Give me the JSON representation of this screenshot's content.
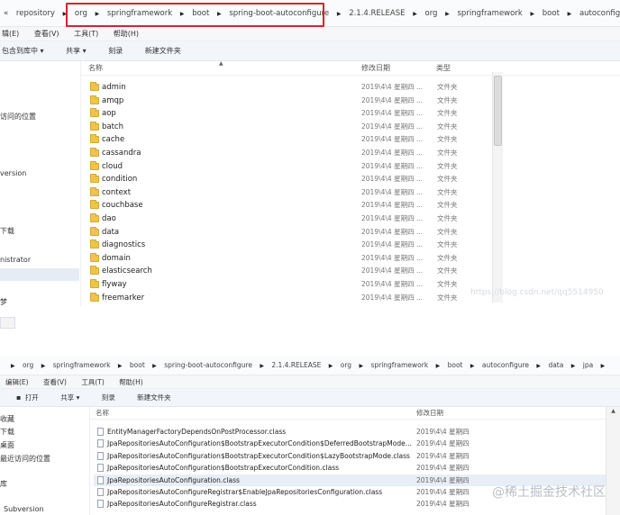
{
  "window1": {
    "breadcrumb": [
      "«",
      "repository",
      "org",
      "springframework",
      "boot",
      "spring-boot-autoconfigure",
      "2.1.4.RELEASE",
      "org",
      "springframework",
      "boot",
      "autoconfigure"
    ],
    "menu": [
      "辑(E)",
      "查看(V)",
      "工具(T)",
      "帮助(H)"
    ],
    "toolbar": [
      "包含到库中 ▾",
      "共享 ▾",
      "刻录",
      "新建文件夹"
    ],
    "nav": [
      "访问的位置",
      "version",
      "下载",
      "nistrator",
      "梦"
    ],
    "columns": {
      "name": "名称",
      "date": "修改日期",
      "type": "类型"
    },
    "rows": [
      {
        "name": "admin",
        "date": "2019\\4\\4 星期四 ...",
        "type": "文件夹"
      },
      {
        "name": "amqp",
        "date": "2019\\4\\4 星期四 ...",
        "type": "文件夹"
      },
      {
        "name": "aop",
        "date": "2019\\4\\4 星期四 ...",
        "type": "文件夹"
      },
      {
        "name": "batch",
        "date": "2019\\4\\4 星期四 ...",
        "type": "文件夹"
      },
      {
        "name": "cache",
        "date": "2019\\4\\4 星期四 ...",
        "type": "文件夹"
      },
      {
        "name": "cassandra",
        "date": "2019\\4\\4 星期四 ...",
        "type": "文件夹"
      },
      {
        "name": "cloud",
        "date": "2019\\4\\4 星期四 ...",
        "type": "文件夹"
      },
      {
        "name": "condition",
        "date": "2019\\4\\4 星期四 ...",
        "type": "文件夹"
      },
      {
        "name": "context",
        "date": "2019\\4\\4 星期四 ...",
        "type": "文件夹"
      },
      {
        "name": "couchbase",
        "date": "2019\\4\\4 星期四 ...",
        "type": "文件夹"
      },
      {
        "name": "dao",
        "date": "2019\\4\\4 星期四 ...",
        "type": "文件夹"
      },
      {
        "name": "data",
        "date": "2019\\4\\4 星期四 ...",
        "type": "文件夹"
      },
      {
        "name": "diagnostics",
        "date": "2019\\4\\4 星期四 ...",
        "type": "文件夹"
      },
      {
        "name": "domain",
        "date": "2019\\4\\4 星期四 ...",
        "type": "文件夹"
      },
      {
        "name": "elasticsearch",
        "date": "2019\\4\\4 星期四 ...",
        "type": "文件夹"
      },
      {
        "name": "flyway",
        "date": "2019\\4\\4 星期四 ...",
        "type": "文件夹"
      },
      {
        "name": "freemarker",
        "date": "2019\\4\\4 星期四 ...",
        "type": "文件夹"
      }
    ],
    "watermark": "https://blog.csdn.net/qq5514950"
  },
  "window2": {
    "breadcrumb": [
      "«",
      "org",
      "springframework",
      "boot",
      "spring-boot-autoconfigure",
      "2.1.4.RELEASE",
      "org",
      "springframework",
      "boot",
      "autoconfigure",
      "data",
      "jpa"
    ],
    "menu": [
      "编辑(E)",
      "查看(V)",
      "工具(T)",
      "帮助(H)"
    ],
    "toolbar": [
      "打开",
      "共享 ▾",
      "刻录",
      "新建文件夹"
    ],
    "nav": [
      "收藏",
      "下载",
      "桌面",
      "最近访问的位置",
      "库",
      "Subversion"
    ],
    "columns": {
      "name": "名称",
      "date": "修改日期"
    },
    "rows": [
      {
        "name": "EntityManagerFactoryDependsOnPostProcessor.class",
        "date": "2019\\4\\4 星期四"
      },
      {
        "name": "JpaRepositoriesAutoConfiguration$BootstrapExecutorCondition$DeferredBootstrapMode...",
        "date": "2019\\4\\4 星期四"
      },
      {
        "name": "JpaRepositoriesAutoConfiguration$BootstrapExecutorCondition$LazyBootstrapMode.class",
        "date": "2019\\4\\4 星期四"
      },
      {
        "name": "JpaRepositoriesAutoConfiguration$BootstrapExecutorCondition.class",
        "date": "2019\\4\\4 星期四"
      },
      {
        "name": "JpaRepositoriesAutoConfiguration.class",
        "date": "2019\\4\\4 星期四"
      },
      {
        "name": "JpaRepositoriesAutoConfigureRegistrar$EnableJpaRepositoriesConfiguration.class",
        "date": "2019\\4\\4 星期四"
      },
      {
        "name": "JpaRepositoriesAutoConfigureRegistrar.class",
        "date": "2019\\4\\4 星期四"
      }
    ],
    "watermark": "@稀土掘金技术社区"
  }
}
